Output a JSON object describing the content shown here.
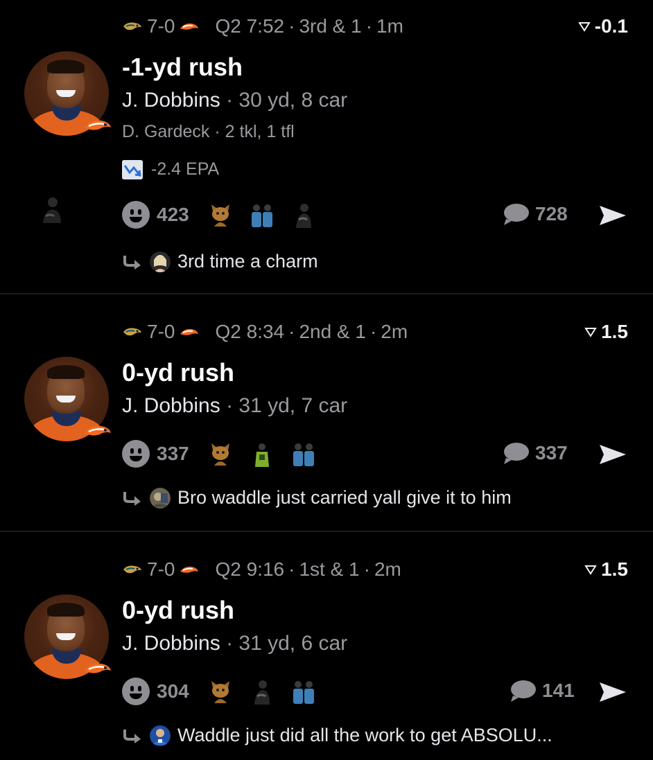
{
  "posts": [
    {
      "score": "7-0",
      "clock": "Q2 7:52",
      "down": "3rd & 1",
      "age": "1m",
      "delta": "-0.1",
      "title": "-1-yd rush",
      "player": "J. Dobbins",
      "player_stats": "30 yd, 8 car",
      "defender": "D. Gardeck",
      "defender_stats": "2 tkl, 1 tfl",
      "epa": "-2.4 EPA",
      "reactions": "423",
      "comments": "728",
      "reply_text": "3rd time a charm"
    },
    {
      "score": "7-0",
      "clock": "Q2 8:34",
      "down": "2nd & 1",
      "age": "2m",
      "delta": "1.5",
      "title": "0-yd rush",
      "player": "J. Dobbins",
      "player_stats": "31 yd, 7 car",
      "reactions": "337",
      "comments": "337",
      "reply_text": "Bro waddle just carried yall give it to him"
    },
    {
      "score": "7-0",
      "clock": "Q2 9:16",
      "down": "1st & 1",
      "age": "2m",
      "delta": "1.5",
      "title": "0-yd rush",
      "player": "J. Dobbins",
      "player_stats": "31 yd, 6 car",
      "reactions": "304",
      "comments": "141",
      "reply_text": "Waddle just did all the work to get ABSOLU..."
    }
  ],
  "sep": " · ",
  "colors": {
    "background": "#000000",
    "muted": "#9a9a9f",
    "jersey": "#e2621f",
    "separator": "#1c1c1e"
  },
  "icons": [
    "jaguars-logo-icon",
    "broncos-logo-icon",
    "trend-down-icon",
    "smiley-icon",
    "chat-bubble-icon",
    "share-arrow-icon",
    "reply-arrow-icon",
    "triangle-delta-icon"
  ]
}
